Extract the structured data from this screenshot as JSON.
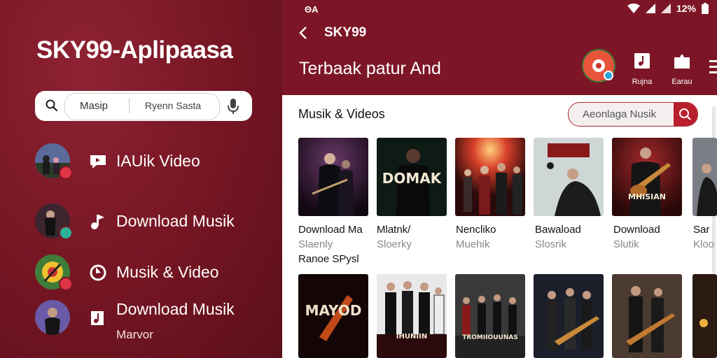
{
  "left": {
    "app_title": "SKY99-Aplipaasa",
    "search": {
      "left_text": "Masip",
      "right_text": "Ryenn Sasta"
    },
    "menu": [
      {
        "label": "IAUik Video",
        "sub": ""
      },
      {
        "label": "Download Musik",
        "sub": ""
      },
      {
        "label": "Musik & Video",
        "sub": ""
      },
      {
        "label": "Download Musik",
        "sub": "Marvor"
      }
    ]
  },
  "right": {
    "status": {
      "left": "ΘA",
      "battery": "12%"
    },
    "title": "SKY99",
    "subtitle": "Terbaak patur And",
    "toolbar": [
      {
        "label": "Rujna"
      },
      {
        "label": "Earau"
      }
    ],
    "section_title": "Musik & Videos",
    "search_placeholder": "Aeonlaga Nusik",
    "cards_row1": [
      {
        "title": "Download Ma",
        "sub": "Slaenly"
      },
      {
        "title": "Mlatnk/",
        "sub": "Sloerky"
      },
      {
        "title": "Nencliko",
        "sub": "Muehik"
      },
      {
        "title": "Bawaload",
        "sub": "Slosrik"
      },
      {
        "title": "Download",
        "sub": "Slutik"
      },
      {
        "title": "Sar",
        "sub": "Kloo"
      }
    ],
    "row1_extra": "Ranoe SPysl",
    "card_overlays": {
      "r1c2": "DOMAK",
      "r1c5": "MHISIAN",
      "r2c1": "MAYOD",
      "r2c2": "IHUNIIN",
      "r2c3": "TROMIIOUUNAS"
    }
  }
}
